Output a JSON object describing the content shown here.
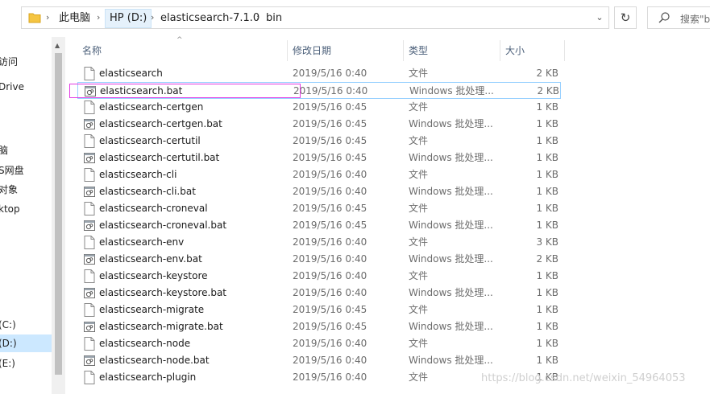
{
  "breadcrumb": {
    "items": [
      "此电脑",
      "HP (D:)",
      "elasticsearch-7.1.0",
      "bin"
    ],
    "selected_index": 1
  },
  "search": {
    "placeholder": "搜索\"b"
  },
  "nav": {
    "items": [
      "访问",
      "Drive",
      "",
      "",
      "脑",
      "S网盘",
      "对象",
      "ktop",
      "",
      "",
      "",
      "",
      "",
      "(C:)",
      "(D:)",
      "(E:)"
    ],
    "selected_index": 14
  },
  "columns": {
    "name": "名称",
    "date": "修改日期",
    "type": "类型",
    "size": "大小"
  },
  "files": [
    {
      "name": "elasticsearch",
      "date": "2019/5/16 0:40",
      "type": "文件",
      "size": "2 KB",
      "icon": "file-icon"
    },
    {
      "name": "elasticsearch.bat",
      "date": "2019/5/16 0:40",
      "type": "Windows 批处理...",
      "size": "2 KB",
      "icon": "bat-file-icon"
    },
    {
      "name": "elasticsearch-certgen",
      "date": "2019/5/16 0:45",
      "type": "文件",
      "size": "1 KB",
      "icon": "file-icon"
    },
    {
      "name": "elasticsearch-certgen.bat",
      "date": "2019/5/16 0:45",
      "type": "Windows 批处理...",
      "size": "1 KB",
      "icon": "bat-file-icon"
    },
    {
      "name": "elasticsearch-certutil",
      "date": "2019/5/16 0:45",
      "type": "文件",
      "size": "1 KB",
      "icon": "file-icon"
    },
    {
      "name": "elasticsearch-certutil.bat",
      "date": "2019/5/16 0:45",
      "type": "Windows 批处理...",
      "size": "1 KB",
      "icon": "bat-file-icon"
    },
    {
      "name": "elasticsearch-cli",
      "date": "2019/5/16 0:40",
      "type": "文件",
      "size": "1 KB",
      "icon": "file-icon"
    },
    {
      "name": "elasticsearch-cli.bat",
      "date": "2019/5/16 0:40",
      "type": "Windows 批处理...",
      "size": "1 KB",
      "icon": "bat-file-icon"
    },
    {
      "name": "elasticsearch-croneval",
      "date": "2019/5/16 0:45",
      "type": "文件",
      "size": "1 KB",
      "icon": "file-icon"
    },
    {
      "name": "elasticsearch-croneval.bat",
      "date": "2019/5/16 0:45",
      "type": "Windows 批处理...",
      "size": "1 KB",
      "icon": "bat-file-icon"
    },
    {
      "name": "elasticsearch-env",
      "date": "2019/5/16 0:40",
      "type": "文件",
      "size": "3 KB",
      "icon": "file-icon"
    },
    {
      "name": "elasticsearch-env.bat",
      "date": "2019/5/16 0:40",
      "type": "Windows 批处理...",
      "size": "2 KB",
      "icon": "bat-file-icon"
    },
    {
      "name": "elasticsearch-keystore",
      "date": "2019/5/16 0:40",
      "type": "文件",
      "size": "1 KB",
      "icon": "file-icon"
    },
    {
      "name": "elasticsearch-keystore.bat",
      "date": "2019/5/16 0:40",
      "type": "Windows 批处理...",
      "size": "1 KB",
      "icon": "bat-file-icon"
    },
    {
      "name": "elasticsearch-migrate",
      "date": "2019/5/16 0:45",
      "type": "文件",
      "size": "1 KB",
      "icon": "file-icon"
    },
    {
      "name": "elasticsearch-migrate.bat",
      "date": "2019/5/16 0:45",
      "type": "Windows 批处理...",
      "size": "1 KB",
      "icon": "bat-file-icon"
    },
    {
      "name": "elasticsearch-node",
      "date": "2019/5/16 0:40",
      "type": "文件",
      "size": "1 KB",
      "icon": "file-icon"
    },
    {
      "name": "elasticsearch-node.bat",
      "date": "2019/5/16 0:40",
      "type": "Windows 批处理...",
      "size": "1 KB",
      "icon": "bat-file-icon"
    },
    {
      "name": "elasticsearch-plugin",
      "date": "2019/5/16 0:40",
      "type": "文件",
      "size": "1 KB",
      "icon": "file-icon"
    }
  ],
  "selected_file_index": 1,
  "watermark": "https://blog.csdn.net/weixin_54964053",
  "colors": {
    "selection_border": "#99d1ff",
    "annotation_box": "#e23ae2",
    "nav_selected": "#cce8ff"
  }
}
